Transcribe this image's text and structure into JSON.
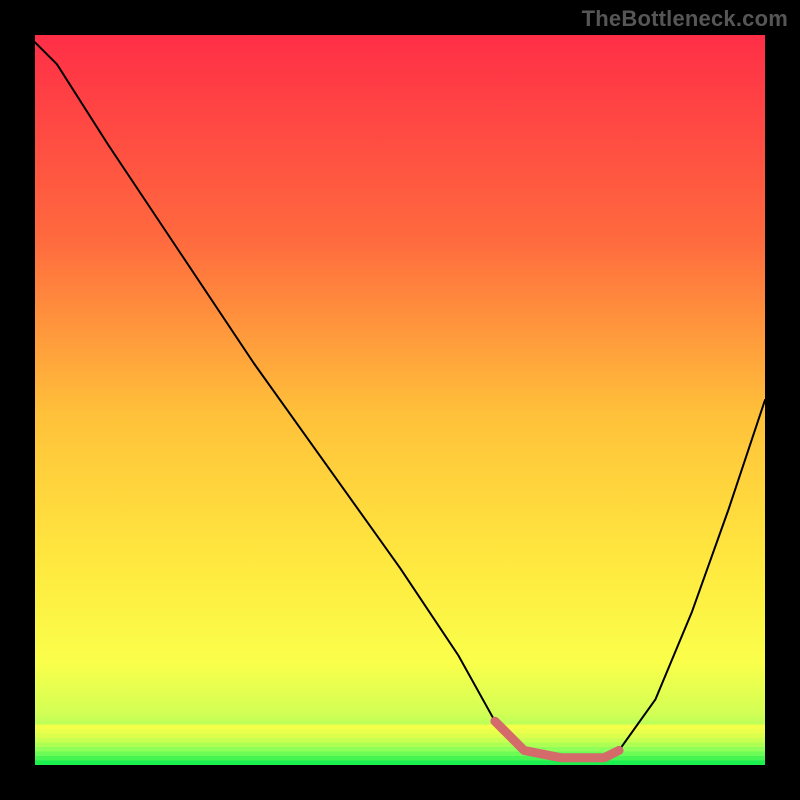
{
  "watermark": "TheBottleneck.com",
  "colors": {
    "gradient_top": "#ff2e47",
    "gradient_mid1": "#ff6a3e",
    "gradient_mid2": "#ffc13a",
    "gradient_mid3": "#ffe83f",
    "gradient_mid4": "#faff4a",
    "gradient_mid5": "#d2ff55",
    "gradient_mid6": "#8fff60",
    "gradient_bottom": "#1cf04e",
    "curve": "#000000",
    "highlight": "#d46a6a",
    "background": "#000000"
  },
  "chart_data": {
    "type": "line",
    "title": "",
    "xlabel": "",
    "ylabel": "",
    "xlim": [
      0,
      100
    ],
    "ylim": [
      0,
      100
    ],
    "x": [
      0,
      3,
      10,
      20,
      30,
      40,
      50,
      58,
      63,
      67,
      72,
      78,
      80,
      85,
      90,
      95,
      100
    ],
    "values": [
      99,
      96,
      85,
      70,
      55,
      41,
      27,
      15,
      6,
      2,
      1,
      1,
      2,
      9,
      21,
      35,
      50
    ],
    "optimal_range_x": [
      63,
      80
    ],
    "optimal_range_values": [
      6,
      2,
      1,
      1,
      2
    ],
    "optimal_range_x_points": [
      63,
      67,
      72,
      78,
      80
    ]
  }
}
